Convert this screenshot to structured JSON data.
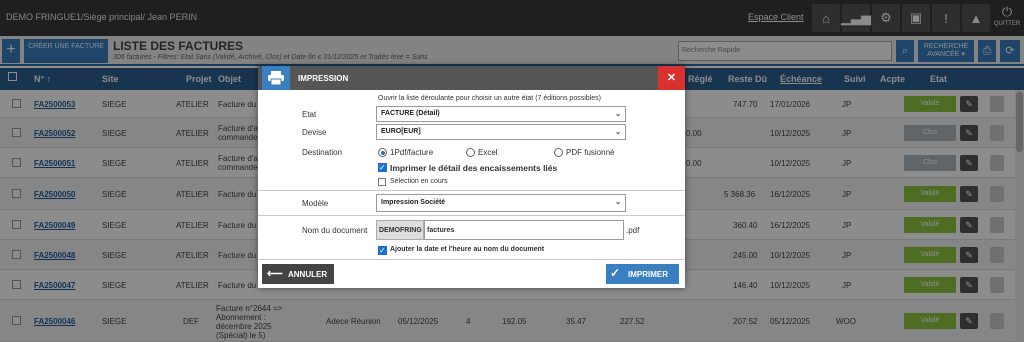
{
  "topbar": {
    "user": "DEMO FRINGUE1/Siège principal/ Jean PERIN",
    "espace_client": "Espace Client",
    "quit_label": "QUITTER"
  },
  "header2": {
    "create_label": "CRÉER UNE FACTURE",
    "title": "LISTE DES FACTURES",
    "subtitle": "306 factures - Filtres: Etat Sans (Validé, Archivé, Clos) et Date fin ≤ 31/12/2025 et Traités levé = Sans",
    "search_placeholder": "Recherche Rapide",
    "advanced_label": "RECHERCHE AVANCÉE ▾"
  },
  "table": {
    "headers": [
      "N° ↑",
      "Site",
      "Projet",
      "Objet",
      "Réglé",
      "Reste Dû",
      "Échéance",
      "Suivi",
      "Acpte",
      "Etat"
    ],
    "rows": [
      {
        "num": "FA2500053",
        "site": "SIEGE",
        "projet": "ATELIER",
        "objet": "Facture du",
        "regle": "",
        "reste": "747.70",
        "echeance": "17/01/2026",
        "suivi": "JP",
        "etat": "Validé"
      },
      {
        "num": "FA2500052",
        "site": "SIEGE",
        "projet": "ATELIER",
        "objet": "Facture d'a commande",
        "regle": "0.00",
        "reste": "",
        "echeance": "10/12/2025",
        "suivi": "JP",
        "etat": "Clos"
      },
      {
        "num": "FA2500051",
        "site": "SIEGE",
        "projet": "ATELIER",
        "objet": "Facture d'a commande",
        "regle": "0.00",
        "reste": "",
        "echeance": "10/12/2025",
        "suivi": "JP",
        "etat": "Clos"
      },
      {
        "num": "FA2500050",
        "site": "SIEGE",
        "projet": "ATELIER",
        "objet": "Facture du",
        "regle": "",
        "reste": "5 368.36",
        "echeance": "16/12/2025",
        "suivi": "JP",
        "etat": "Validé"
      },
      {
        "num": "FA2500049",
        "site": "SIEGE",
        "projet": "ATELIER",
        "objet": "Facture du",
        "regle": "",
        "reste": "360.40",
        "echeance": "16/12/2025",
        "suivi": "JP",
        "etat": "Validé"
      },
      {
        "num": "FA2500048",
        "site": "SIEGE",
        "projet": "ATELIER",
        "objet": "Facture du",
        "regle": "",
        "reste": "245.00",
        "echeance": "10/12/2025",
        "suivi": "JP",
        "etat": "Validé"
      },
      {
        "num": "FA2500047",
        "site": "SIEGE",
        "projet": "ATELIER",
        "objet": "Facture du",
        "regle": "",
        "reste": "146.40",
        "echeance": "10/12/2025",
        "suivi": "JP",
        "etat": "Validé"
      },
      {
        "num": "FA2500046",
        "site": "SIEGE",
        "projet": "DEF",
        "objet": "Facture n°2644 => Abonnement : décembre 2025 (Spécial) le 5)",
        "client": "Adece Réunion",
        "date": "05/12/2025",
        "qte": "4",
        "ht": "192.05",
        "tva": "35.47",
        "ttc": "227.52",
        "regle": "",
        "reste": "207.52",
        "echeance": "05/12/2025",
        "suivi": "WOO",
        "etat": "Validé"
      }
    ]
  },
  "modal": {
    "title": "IMPRESSION",
    "hint": "Ouvrir la liste déroulante pour choisir un autre état (7 éditions possibles)",
    "etat_label": "Etat",
    "etat_value": "FACTURE (Détail)",
    "devise_label": "Devise",
    "devise_value": "EURO[EUR]",
    "destination_label": "Destination",
    "dest_options": [
      "1Pdf/facture",
      "Excel",
      "PDF fusionné"
    ],
    "encaissements_label": "Imprimer le détail des encaissements liés",
    "selection_label": "Sélection en cours",
    "modele_label": "Modèle",
    "modele_value": "Impression Société",
    "nomdoc_label": "Nom du document",
    "nomdoc_prefix": "DEMOFRING",
    "nomdoc_value": "factures",
    "nomdoc_ext": ".pdf",
    "ajouter_date_label": "Ajouter la date et l'heure au nom du document",
    "annuler_label": "ANNULER",
    "imprimer_label": "IMPRIMER"
  }
}
